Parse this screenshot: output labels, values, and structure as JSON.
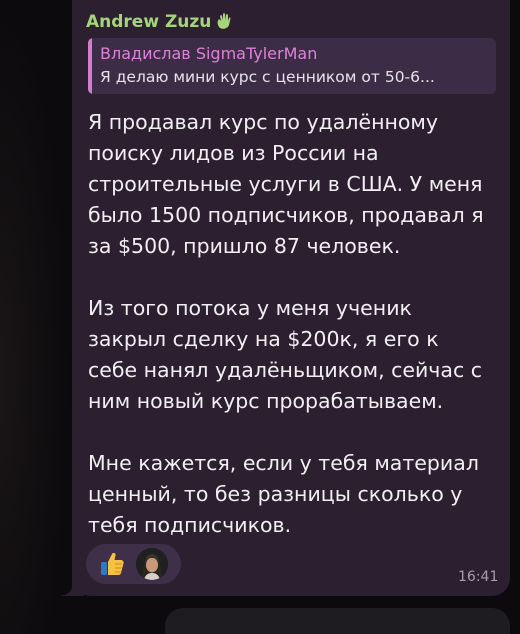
{
  "message": {
    "sender_name": "Andrew Zuzu",
    "sender_emoji_icon": "waving-hand-icon",
    "reply": {
      "author": "Владислав SigmaTylerMan",
      "text": "Я делаю мини курс с ценником от 50-6..."
    },
    "paragraphs": [
      "Я продавал курс по удалённому\nпоиску лидов из России на\nстроительные услуги в США. У меня\nбыло 1500 подписчиков, продавал я\nза $500, пришло 87 человек.",
      "Из того потока у меня ученик\nзакрыл сделку на $200к, я его к\nсебе нанял удалёньщиком, сейчас с\nним новый курс прорабатываем.",
      "Мне кажется, если у тебя материал\nценный, то без разницы сколько у\nтебя подписчиков."
    ],
    "reactions": [
      {
        "icon": "thumbs-up-icon"
      },
      {
        "icon": "user-avatar"
      }
    ],
    "time": "16:41"
  },
  "colors": {
    "bubble": "#2b1f30",
    "sender": "#a6d47a",
    "reply_accent": "#d57bd0",
    "text": "#f2eff3"
  }
}
